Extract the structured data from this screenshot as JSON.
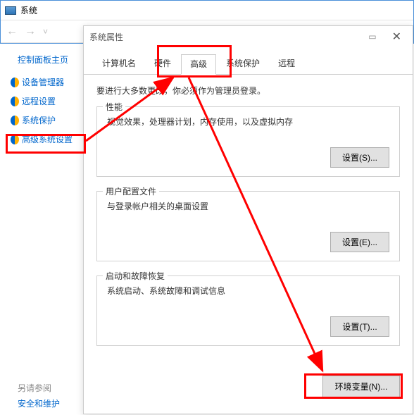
{
  "back_window": {
    "title": "系统",
    "sidebar_header": "控制面板主页",
    "items": [
      {
        "label": "设备管理器"
      },
      {
        "label": "远程设置"
      },
      {
        "label": "系统保护"
      },
      {
        "label": "高级系统设置"
      }
    ],
    "see_also_label": "另请参阅",
    "see_also_link": "安全和维护"
  },
  "dialog": {
    "title": "系统属性",
    "tabs": [
      {
        "label": "计算机名"
      },
      {
        "label": "硬件"
      },
      {
        "label": "高级"
      },
      {
        "label": "系统保护"
      },
      {
        "label": "远程"
      }
    ],
    "intro": "要进行大多数更改，你必须作为管理员登录。",
    "group_performance": {
      "title": "性能",
      "desc": "视觉效果，处理器计划，内存使用，以及虚拟内存",
      "button": "设置(S)..."
    },
    "group_profile": {
      "title": "用户配置文件",
      "desc": "与登录帐户相关的桌面设置",
      "button": "设置(E)..."
    },
    "group_startup": {
      "title": "启动和故障恢复",
      "desc": "系统启动、系统故障和调试信息",
      "button": "设置(T)..."
    },
    "env_button": "环境变量(N)..."
  }
}
